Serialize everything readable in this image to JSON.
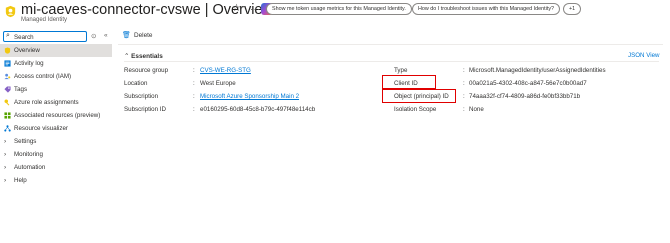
{
  "header": {
    "title": "mi-caeves-connector-cvswe | Overview",
    "subtitle": "Managed Identity",
    "pills": [
      "Show me token usage metrics for this Managed Identity.",
      "How do I troubleshoot issues with this Managed Identity?",
      "+1"
    ],
    "more_label": "···"
  },
  "sidebar": {
    "search_placeholder": "Search",
    "collapse_label": "«",
    "filter_label": "⊙",
    "items": [
      {
        "label": "Overview",
        "icon": "managed-identity-icon",
        "active": true
      },
      {
        "label": "Activity log",
        "icon": "activity-log-icon"
      },
      {
        "label": "Access control (IAM)",
        "icon": "access-control-icon"
      },
      {
        "label": "Tags",
        "icon": "tag-icon"
      },
      {
        "label": "Azure role assignments",
        "icon": "key-icon"
      },
      {
        "label": "Associated resources (preview)",
        "icon": "grid-icon"
      },
      {
        "label": "Resource visualizer",
        "icon": "visualizer-icon"
      },
      {
        "label": "Settings",
        "group": true
      },
      {
        "label": "Monitoring",
        "group": true
      },
      {
        "label": "Automation",
        "group": true
      },
      {
        "label": "Help",
        "group": true
      }
    ]
  },
  "toolbar": {
    "delete_label": "Delete"
  },
  "essentials": {
    "heading": "Essentials",
    "json_view": "JSON View",
    "left": [
      {
        "label": "Resource group",
        "value": "CVS-WE-RG-STG",
        "link": true
      },
      {
        "label": "Location",
        "value": "West Europe",
        "link": false
      },
      {
        "label": "Subscription",
        "value": "Microsoft Azure Sponsorship Main 2",
        "link": true
      },
      {
        "label": "Subscription ID",
        "value": "e0160295-60d8-45c8-b79c-497f48e114cb",
        "link": false
      }
    ],
    "right": [
      {
        "label": "Type",
        "value": "Microsoft.ManagedIdentity/userAssignedIdentities",
        "highlight": false
      },
      {
        "label": "Client ID",
        "value": "00a021a5-4302-408c-a847-56e7c0b00ad7",
        "highlight": true
      },
      {
        "label": "Object (principal) ID",
        "value": "74aaa32f-cf74-4809-a86d-fe0bf33bb71b",
        "highlight": true
      },
      {
        "label": "Isolation Scope",
        "value": "None",
        "highlight": false
      }
    ],
    "separator": ":"
  },
  "colors": {
    "accent": "#0078d4",
    "highlight_box": "#e00000",
    "active_nav": "#e1dfdd"
  }
}
